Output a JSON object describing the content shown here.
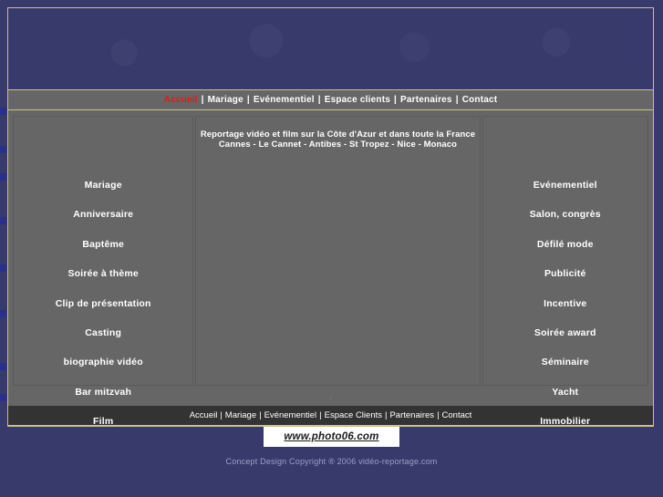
{
  "site": {
    "background_color": "#373a6b",
    "border_color": "#c9c08a",
    "panel_color": "#666666",
    "accent_color": "#d81f16"
  },
  "header": {
    "banner_alt": "video reportage banner"
  },
  "topnav": {
    "separator": "|",
    "items": [
      {
        "label": "Accueil",
        "active": true
      },
      {
        "label": "Mariage",
        "active": false
      },
      {
        "label": "Evénementiel",
        "active": false
      },
      {
        "label": "Espace clients",
        "active": false
      },
      {
        "label": "Partenaires",
        "active": false
      },
      {
        "label": "Contact",
        "active": false
      }
    ]
  },
  "main": {
    "tagline_line1": "Reportage vidéo et film sur la Côte d'Azur et dans toute la France",
    "tagline_line2": "Cannes - Le Cannet - Antibes - St Tropez - Nice - Monaco",
    "left_menu": [
      {
        "label": "Mariage"
      },
      {
        "label": "Anniversaire"
      },
      {
        "label": "Baptême"
      },
      {
        "label": "Soirée à thème"
      },
      {
        "label": "Clip de présentation"
      },
      {
        "label": "Casting"
      },
      {
        "label": "biographie vidéo"
      },
      {
        "label": "Bar mitzvah"
      },
      {
        "label": "Film"
      }
    ],
    "right_menu": [
      {
        "label": "Evénementiel"
      },
      {
        "label": "Salon, congrès"
      },
      {
        "label": "Défilé mode"
      },
      {
        "label": "Publicité"
      },
      {
        "label": "Incentive"
      },
      {
        "label": "Soirée award"
      },
      {
        "label": "Séminaire"
      },
      {
        "label": "Yacht"
      },
      {
        "label": "Immobilier"
      }
    ],
    "strip_text": "."
  },
  "bottomnav": {
    "separator": "|",
    "items": [
      {
        "label": "Accueil"
      },
      {
        "label": "Mariage"
      },
      {
        "label": "Evénementiel"
      },
      {
        "label": "Espace Clients"
      },
      {
        "label": "Partenaires"
      },
      {
        "label": "Contact"
      }
    ]
  },
  "logo": {
    "text": "www.photo06.com"
  },
  "footer": {
    "copyright": "Concept Design Copyright ® 2006 vidéo-reportage.com"
  }
}
